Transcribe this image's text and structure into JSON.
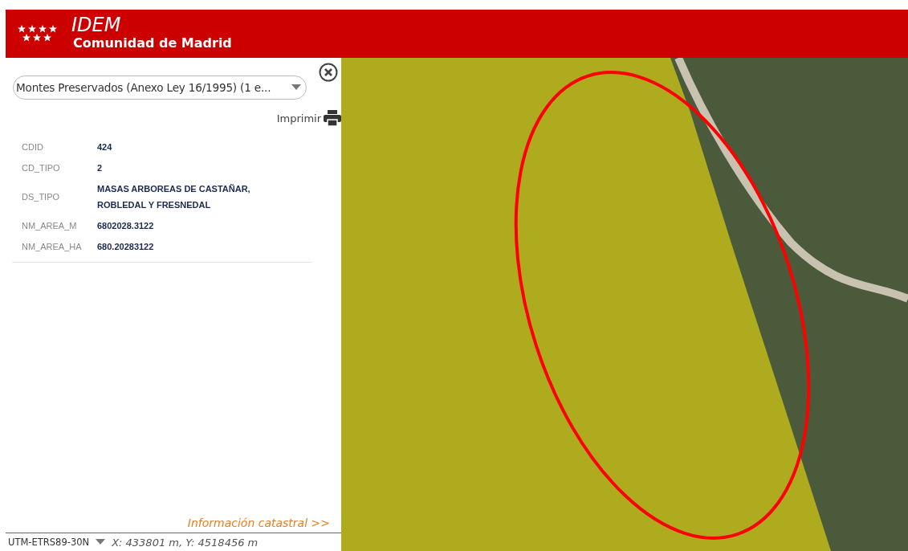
{
  "header": {
    "title": "IDEM",
    "subtitle": "Comunidad de Madrid"
  },
  "panel": {
    "layer_select": "Montes Preservados (Anexo Ley 16/1995) (1 e...",
    "print_label": "Imprimir",
    "attributes": [
      {
        "name": "CDID",
        "value": "424"
      },
      {
        "name": "CD_TIPO",
        "value": "2"
      },
      {
        "name": "DS_TIPO",
        "value": "MASAS ARBOREAS DE CASTAÑAR, ROBLEDAL Y FRESNEDAL"
      },
      {
        "name": "NM_AREA_M",
        "value": "6802028.3122"
      },
      {
        "name": "NM_AREA_HA",
        "value": "680.20283122"
      }
    ],
    "cadastre_link": "Información catastral >>"
  },
  "status_bar": {
    "projection": "UTM-ETRS89-30N",
    "coordinates": "X: 433801 m, Y: 4518456 m"
  }
}
